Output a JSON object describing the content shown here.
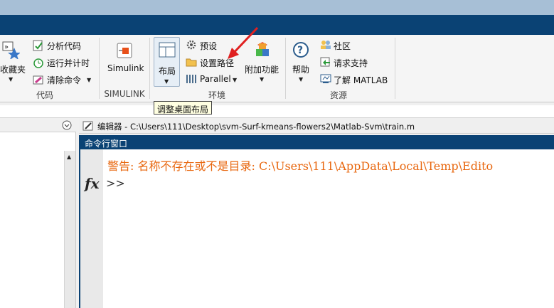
{
  "ribbon": {
    "favorites_label": "收藏夹",
    "analyze_code": "分析代码",
    "run_and_time": "运行并计时",
    "clear_commands": "清除命令",
    "code_group": "代码",
    "simulink_btn": "Simulink",
    "simulink_group": "SIMULINK",
    "layout_btn": "布局",
    "preferences": "预设",
    "set_path": "设置路径",
    "parallel": "Parallel",
    "addons": "附加功能",
    "environment_group": "环境",
    "help": "帮助",
    "community": "社区",
    "request_support": "请求支持",
    "learn_matlab": "了解 MATLAB",
    "resources_group": "资源"
  },
  "tooltip": {
    "text": "调整桌面布局"
  },
  "editor": {
    "title": "编辑器 - C:\\Users\\111\\Desktop\\svm-Surf-kmeans-flowers2\\Matlab-Svm\\train.m"
  },
  "command_window": {
    "title": "命令行窗口",
    "fx": "fx",
    "warning": "警告: 名称不存在或不是目录: C:\\Users\\111\\AppData\\Local\\Temp\\Edito",
    "prompt": ">>"
  },
  "colors": {
    "accent": "#0a4274",
    "warning": "#e8670f",
    "arrow": "#e02020"
  }
}
